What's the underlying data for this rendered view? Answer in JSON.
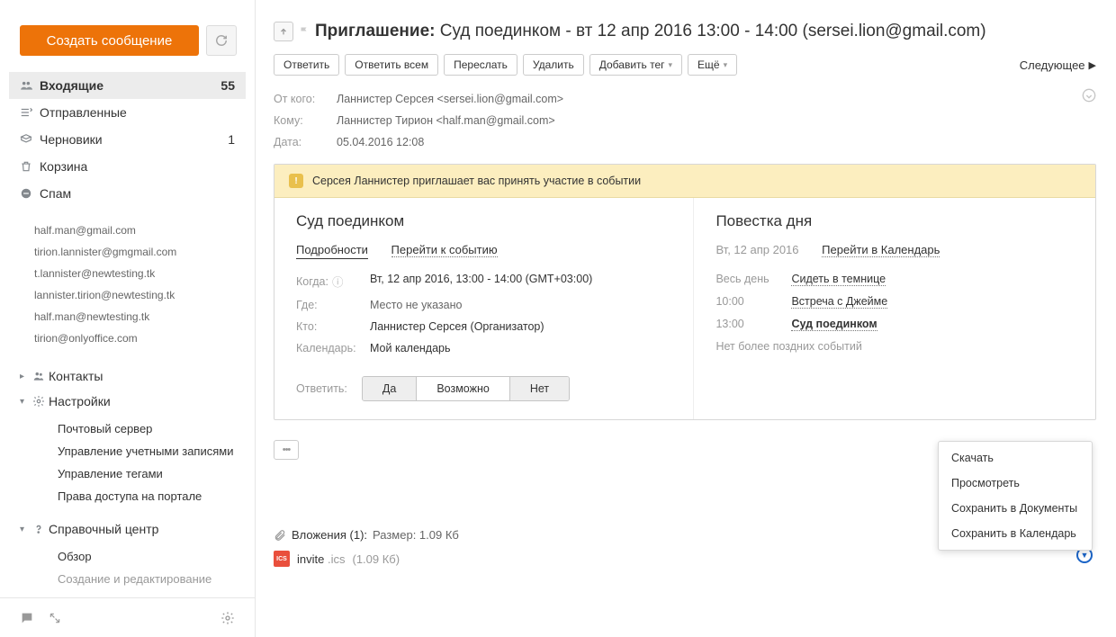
{
  "sidebar": {
    "compose": "Создать сообщение",
    "folders": [
      {
        "label": "Входящие",
        "count": "55",
        "active": true,
        "icon": "users"
      },
      {
        "label": "Отправленные",
        "count": "",
        "active": false,
        "icon": "out"
      },
      {
        "label": "Черновики",
        "count": "1",
        "active": false,
        "icon": "draft"
      },
      {
        "label": "Корзина",
        "count": "",
        "active": false,
        "icon": "trash"
      },
      {
        "label": "Спам",
        "count": "",
        "active": false,
        "icon": "spam"
      }
    ],
    "accounts": [
      "half.man@gmail.com",
      "tirion.lannister@gmgmail.com",
      "t.lannister@newtesting.tk",
      "lannister.tirion@newtesting.tk",
      "half.man@newtesting.tk",
      "tirion@onlyoffice.com"
    ],
    "contacts_label": "Контакты",
    "settings_label": "Настройки",
    "settings_items": [
      "Почтовый сервер",
      "Управление учетными записями",
      "Управление тегами",
      "Права доступа на портале"
    ],
    "help_label": "Справочный центр",
    "help_items": [
      "Обзор",
      "Создание и редактирование"
    ]
  },
  "message": {
    "subject_prefix": "Приглашение:",
    "subject_rest": " Суд поединком - вт 12 апр 2016 13:00 - 14:00 (sersei.lion@gmail.com)",
    "toolbar": {
      "reply": "Ответить",
      "reply_all": "Ответить всем",
      "forward": "Переслать",
      "delete": "Удалить",
      "add_tag": "Добавить тег",
      "more": "Ещё",
      "next": "Следующее"
    },
    "meta": {
      "from_k": "От кого:",
      "from_v": "Ланнистер Серсея <sersei.lion@gmail.com>",
      "to_k": "Кому:",
      "to_v": "Ланнистер Тирион <half.man@gmail.com>",
      "date_k": "Дата:",
      "date_v": "05.04.2016  12:08"
    },
    "invite": {
      "banner": "Серсея Ланнистер приглашает вас принять участие в событии",
      "event_title": "Суд поединком",
      "tab_details": "Подробности",
      "tab_goto": "Перейти к событию",
      "when_k": "Когда:",
      "when_v": "Вт, 12 апр 2016, 13:00 - 14:00 (GMT+03:00)",
      "where_k": "Где:",
      "where_v": "Место не указано",
      "who_k": "Кто:",
      "who_v": "Ланнистер Серсея (Организатор)",
      "cal_k": "Календарь:",
      "cal_v": "Мой календарь",
      "respond_k": "Ответить:",
      "yes": "Да",
      "maybe": "Возможно",
      "no": "Нет",
      "agenda_title": "Повестка дня",
      "agenda_date": "Вт, 12 апр 2016",
      "agenda_goto": "Перейти в Календарь",
      "agenda": [
        {
          "t": "Весь день",
          "e": "Сидеть в темнице",
          "bold": false
        },
        {
          "t": "10:00",
          "e": "Встреча с Джейме",
          "bold": false
        },
        {
          "t": "13:00",
          "e": "Суд поединком",
          "bold": true
        }
      ],
      "agenda_no_more": "Нет более поздних событий"
    },
    "attach": {
      "clip": "📎",
      "header_label": "Вложения (1):",
      "size_label": "Размер: 1.09 Кб",
      "file_name": "invite",
      "file_ext": ".ics",
      "file_size": "(1.09 Кб)"
    },
    "attach_menu": [
      "Скачать",
      "Просмотреть",
      "Сохранить в Документы",
      "Сохранить в Календарь"
    ]
  }
}
